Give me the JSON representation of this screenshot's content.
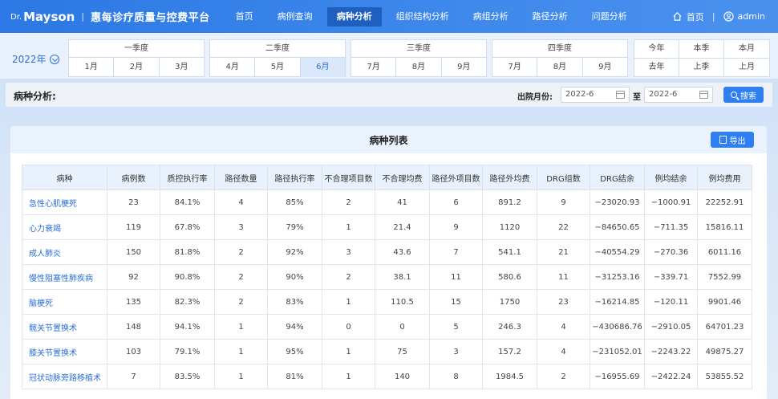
{
  "header": {
    "brand_dr": "Dr.",
    "brand_name": "Mayson",
    "brand_sep": "|",
    "title": "惠每诊疗质量与控费平台",
    "nav": [
      "首页",
      "病例查询",
      "病种分析",
      "组织结构分析",
      "病组分析",
      "路径分析",
      "问题分析"
    ],
    "active_nav": "病种分析",
    "home_label": "首页",
    "user_sep": "|",
    "user": "admin"
  },
  "period": {
    "year": "2022年",
    "quarters": [
      {
        "title": "一季度",
        "months": [
          "1月",
          "2月",
          "3月"
        ]
      },
      {
        "title": "二季度",
        "months": [
          "4月",
          "5月",
          "6月"
        ]
      },
      {
        "title": "三季度",
        "months": [
          "7月",
          "8月",
          "9月"
        ]
      },
      {
        "title": "四季度",
        "months": [
          "7月",
          "8月",
          "9月"
        ]
      }
    ],
    "selected_month": "6月",
    "quick": [
      "今年",
      "本季",
      "本月",
      "去年",
      "上季",
      "上月"
    ]
  },
  "filter": {
    "title": "病种分析:",
    "month_label": "出院月份:",
    "from": "2022-6",
    "to_label": "至",
    "to": "2022-6",
    "search_label": "搜索"
  },
  "panel": {
    "title": "病种列表",
    "export_label": "导出"
  },
  "table": {
    "columns": [
      "病种",
      "病例数",
      "质控执行率",
      "路径数量",
      "路径执行率",
      "不合理项目数",
      "不合理均费",
      "路径外项目数",
      "路径外均费",
      "DRG组数",
      "DRG结余",
      "例均结余",
      "例均费用"
    ],
    "rows": [
      [
        "急性心肌梗死",
        "23",
        "84.1%",
        "4",
        "85%",
        "2",
        "41",
        "6",
        "891.2",
        "9",
        "−23020.93",
        "−1000.91",
        "22252.91"
      ],
      [
        "心力衰竭",
        "119",
        "67.8%",
        "3",
        "79%",
        "1",
        "21.4",
        "9",
        "1120",
        "22",
        "−84650.65",
        "−711.35",
        "15816.11"
      ],
      [
        "成人肺炎",
        "150",
        "81.8%",
        "2",
        "92%",
        "3",
        "43.6",
        "7",
        "541.1",
        "21",
        "−40554.29",
        "−270.36",
        "6011.16"
      ],
      [
        "慢性阻塞性肺疾病",
        "92",
        "90.8%",
        "2",
        "90%",
        "2",
        "38.1",
        "11",
        "580.6",
        "11",
        "−31253.16",
        "−339.71",
        "7552.99"
      ],
      [
        "脑梗死",
        "135",
        "82.3%",
        "2",
        "83%",
        "1",
        "110.5",
        "15",
        "1750",
        "23",
        "−16214.85",
        "−120.11",
        "9901.46"
      ],
      [
        "髋关节置换术",
        "148",
        "94.1%",
        "1",
        "94%",
        "0",
        "0",
        "5",
        "246.3",
        "4",
        "−430686.76",
        "−2910.05",
        "64701.23"
      ],
      [
        "膝关节置换术",
        "103",
        "79.1%",
        "1",
        "95%",
        "1",
        "75",
        "3",
        "157.2",
        "4",
        "−231052.01",
        "−2243.22",
        "49875.27"
      ],
      [
        "冠状动脉旁路移植术",
        "7",
        "83.5%",
        "1",
        "81%",
        "1",
        "140",
        "8",
        "1984.5",
        "2",
        "−16955.69",
        "−2422.24",
        "53855.52"
      ]
    ]
  }
}
